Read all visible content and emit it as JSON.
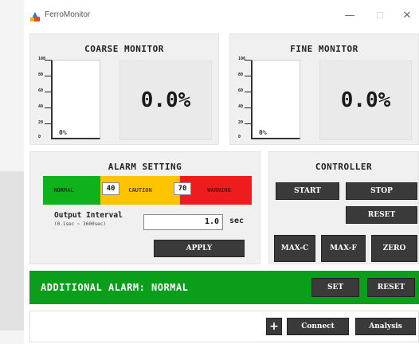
{
  "window": {
    "title": "FerroMonitor",
    "min_glyph": "—",
    "max_glyph": "☐",
    "close_glyph": "✕"
  },
  "coarse": {
    "title": "COARSE MONITOR",
    "level_fraction": 0,
    "bar_label": "0%",
    "readout": "0.0%",
    "tick_labels": [
      "100",
      "80",
      "60",
      "40",
      "20",
      "0"
    ]
  },
  "fine": {
    "title": "FINE MONITOR",
    "level_fraction": 0,
    "bar_label": "0%",
    "readout": "0.0%",
    "tick_labels": [
      "100",
      "80",
      "60",
      "40",
      "20",
      "0"
    ]
  },
  "alarm_setting": {
    "title": "ALARM SETTING",
    "normal_label": "NORMAL",
    "caution_label": "CAUTION",
    "warning_label": "WARNING",
    "threshold_1": "40",
    "threshold_2": "70",
    "output_interval_label": "Output Interval",
    "output_interval_hint": "(0.1sec ~ 3600sec)",
    "output_interval_value": "1.0",
    "output_interval_unit": "sec",
    "apply_label": "APPLY",
    "colors": {
      "normal": "#10b21c",
      "caution": "#ffc400",
      "warning": "#ee1c1c"
    }
  },
  "controller": {
    "title": "CONTROLLER",
    "start_label": "START",
    "stop_label": "STOP",
    "reset_label": "RESET",
    "maxc_label": "MAX-C",
    "maxf_label": "MAX-F",
    "zero_label": "ZERO"
  },
  "additional_alarm": {
    "text": "ADDITIONAL ALARM: NORMAL",
    "set_label": "SET",
    "reset_label": "RESET",
    "color": "#0a9e1a"
  },
  "bottom": {
    "plus_label": "+",
    "connect_label": "Connect",
    "analysis_label": "Analysis"
  }
}
